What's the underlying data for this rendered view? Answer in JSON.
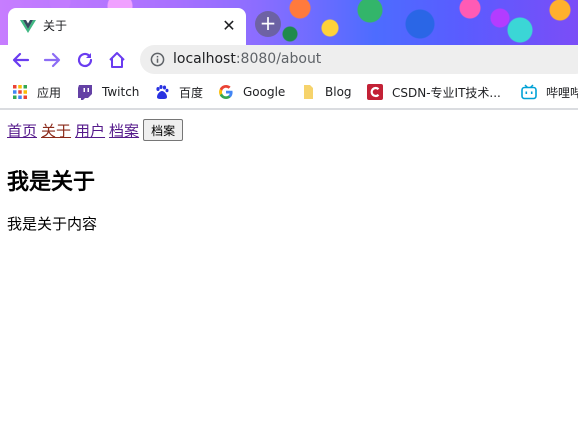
{
  "browser": {
    "tab": {
      "title": "关于",
      "close_glyph": "✕"
    },
    "new_tab_glyph": "+",
    "address": {
      "host": "localhost",
      "rest": ":8080/about"
    },
    "bookmarks": [
      {
        "label": "应用",
        "icon": "apps-grid-icon"
      },
      {
        "label": "Twitch",
        "icon": "twitch-icon"
      },
      {
        "label": "百度",
        "icon": "baidu-icon"
      },
      {
        "label": "Google",
        "icon": "google-icon"
      },
      {
        "label": "Blog",
        "icon": "folder-icon"
      },
      {
        "label": "CSDN-专业IT技术...",
        "icon": "csdn-icon"
      },
      {
        "label": "哔哩哔",
        "icon": "bilibili-icon"
      }
    ],
    "colors": {
      "accent": "#5f3cff",
      "toolbar_icon": "#6a3cf0"
    }
  },
  "page": {
    "nav": {
      "links": [
        "首页",
        "关于",
        "用户",
        "档案"
      ],
      "button_label": "档案"
    },
    "heading": "我是关于",
    "content": "我是关于内容"
  }
}
